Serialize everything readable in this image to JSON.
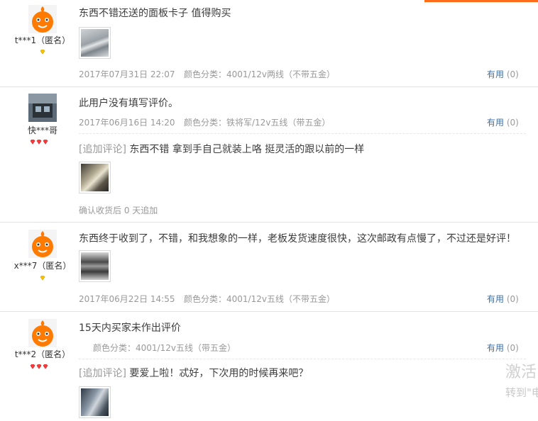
{
  "reviews": [
    {
      "user": {
        "nick": "t***1（匿名）",
        "avatar": "orange-mascot",
        "badge": "yellow-diamond"
      },
      "content": "东西不错还送的面板卡子 值得购买",
      "date": "2017年07月31日 22:07",
      "sku": "颜色分类：4001/12v两线（不带五金）",
      "useful_label": "有用",
      "useful_count": "(0)"
    },
    {
      "user": {
        "nick": "快***哥",
        "avatar": "photo",
        "badge": "red-diamond-3"
      },
      "content": "此用户没有填写评价。",
      "date": "2017年06月16日 14:20",
      "sku": "颜色分类：铁将军/12v五线（带五金）",
      "useful_label": "有用",
      "useful_count": "(0)",
      "append": {
        "tag": "[追加评论]",
        "text": "东西不错 拿到手自己就装上咯 挺灵活的跟以前的一样",
        "time": "确认收货后 0 天追加"
      }
    },
    {
      "user": {
        "nick": "x***7（匿名）",
        "avatar": "orange-mascot",
        "badge": "yellow-diamond"
      },
      "content": "东西终于收到了，不错，和我想象的一样，老板发货速度很快，这次邮政有点慢了，不过还是好评！",
      "date": "2017年06月22日 14:55",
      "sku": "颜色分类：4001/12v五线（不带五金）",
      "useful_label": "有用",
      "useful_count": "(0)"
    },
    {
      "user": {
        "nick": "t***2（匿名）",
        "avatar": "orange-mascot",
        "badge": "red-diamond-3"
      },
      "content": "15天内买家未作出评价",
      "date": "",
      "sku": "颜色分类：4001/12v五线（带五金）",
      "useful_label": "有用",
      "useful_count": "(0)",
      "append": {
        "tag": "[追加评论]",
        "text": "要爱上啦！忒好，下次用的时候再来吧？",
        "time": ""
      }
    }
  ],
  "overlay": {
    "line1": "激活",
    "line2": "转到\"电"
  },
  "colors": {
    "accent": "#ff6d1a",
    "link": "#3d6fa4",
    "muted": "#999999"
  }
}
